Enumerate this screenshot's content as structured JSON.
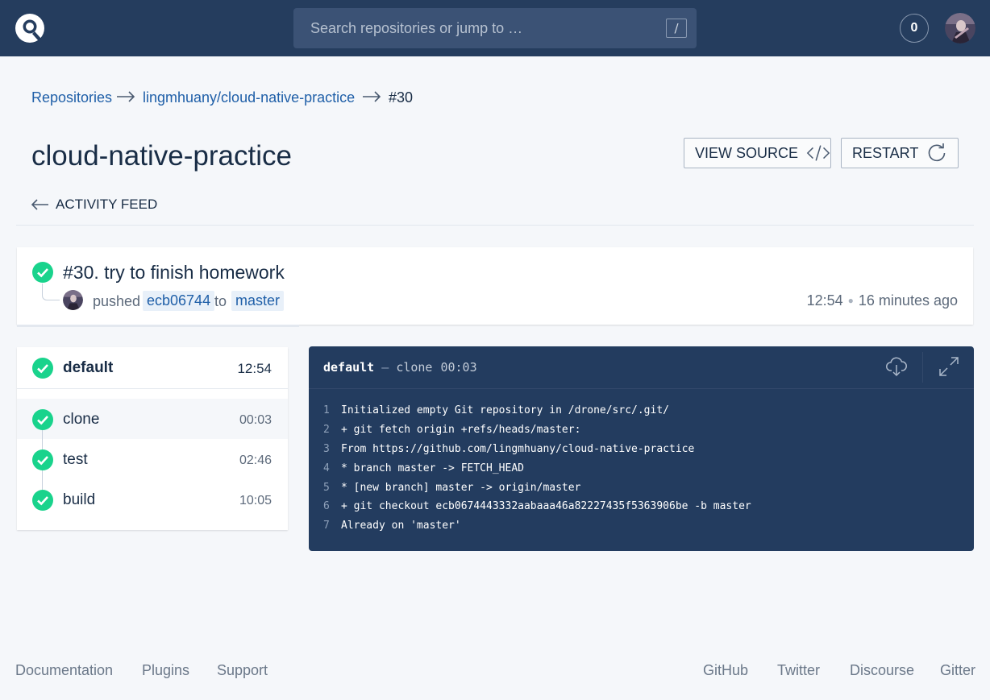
{
  "header": {
    "search_placeholder": "Search repositories or jump to …",
    "search_shortcut": "/",
    "notification_count": "0"
  },
  "breadcrumb": {
    "items": [
      "Repositories",
      "lingmhuany/cloud-native-practice",
      "#30"
    ]
  },
  "page": {
    "title": "cloud-native-practice",
    "view_source_label": "VIEW SOURCE",
    "restart_label": "RESTART",
    "back_label": "ACTIVITY FEED"
  },
  "build": {
    "title": "#30. try to finish homework",
    "action": "pushed",
    "commit": "ecb06744",
    "to_word": "to",
    "branch": "master",
    "time": "12:54",
    "relative_time": "16 minutes ago",
    "status": "success"
  },
  "stage": {
    "name": "default",
    "time": "12:54",
    "steps": [
      {
        "name": "clone",
        "duration": "00:03",
        "status": "success"
      },
      {
        "name": "test",
        "duration": "02:46",
        "status": "success"
      },
      {
        "name": "build",
        "duration": "10:05",
        "status": "success"
      }
    ]
  },
  "log": {
    "stage": "default",
    "separator": "—",
    "step": "clone",
    "duration": "00:03",
    "lines": [
      {
        "n": "1",
        "text": "Initialized empty Git repository in /drone/src/.git/"
      },
      {
        "n": "2",
        "text": "+ git fetch origin +refs/heads/master:"
      },
      {
        "n": "3",
        "text": "From https://github.com/lingmhuany/cloud-native-practice"
      },
      {
        "n": "4",
        "text": "* branch master -> FETCH_HEAD"
      },
      {
        "n": "5",
        "text": "* [new branch] master -> origin/master"
      },
      {
        "n": "6",
        "text": "+ git checkout ecb0674443332aabaaa46a82227435f5363906be -b master"
      },
      {
        "n": "7",
        "text": "Already on 'master'"
      }
    ],
    "icons": [
      "cloud-download-icon",
      "expand-icon"
    ]
  },
  "footer": {
    "left": [
      "Documentation",
      "Plugins",
      "Support"
    ],
    "right": [
      "GitHub",
      "Twitter",
      "Discourse",
      "Gitter"
    ]
  },
  "colors": {
    "topbar": "#253d5e",
    "success": "#19d38c",
    "link": "#1f5fa8",
    "log_bg": "#233c5f"
  }
}
